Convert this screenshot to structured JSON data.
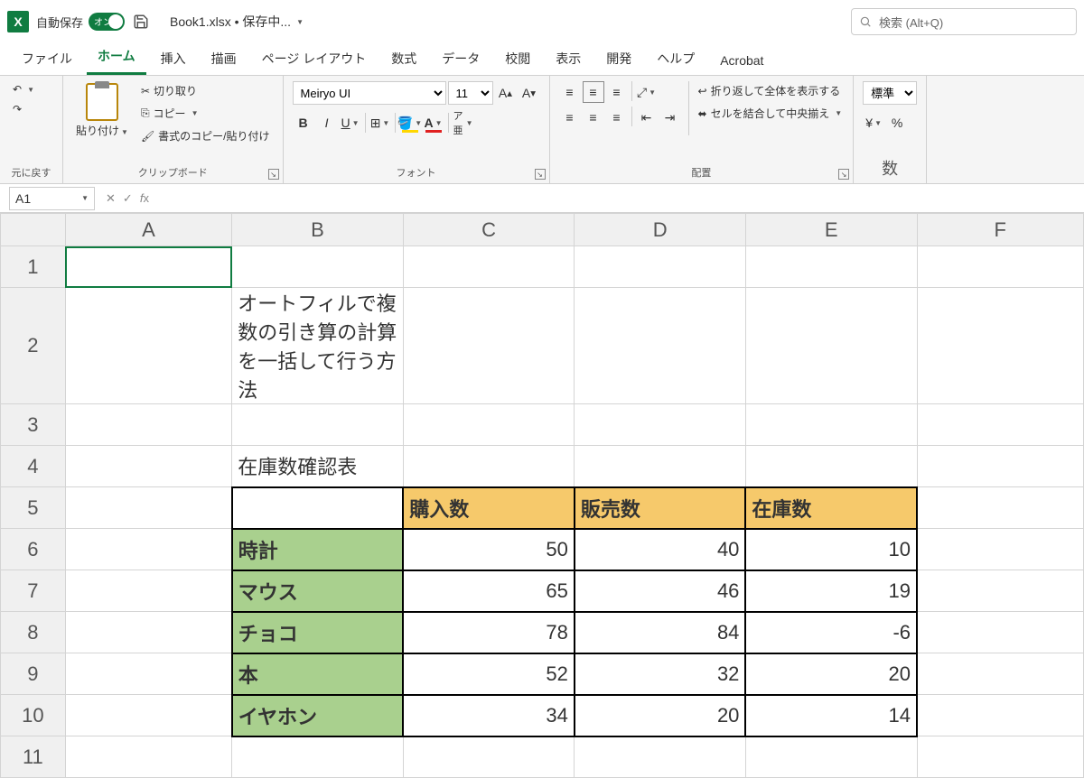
{
  "titlebar": {
    "autosave_label": "自動保存",
    "autosave_state": "オン",
    "filename": "Book1.xlsx • 保存中...",
    "search_placeholder": "検索 (Alt+Q)"
  },
  "tabs": [
    "ファイル",
    "ホーム",
    "挿入",
    "描画",
    "ページ レイアウト",
    "数式",
    "データ",
    "校閲",
    "表示",
    "開発",
    "ヘルプ",
    "Acrobat"
  ],
  "active_tab": "ホーム",
  "ribbon": {
    "undo_group": "元に戻す",
    "clipboard": {
      "paste": "貼り付け",
      "cut": "切り取り",
      "copy": "コピー",
      "format_painter": "書式のコピー/貼り付け",
      "label": "クリップボード"
    },
    "font": {
      "name": "Meiryo UI",
      "size": "11",
      "label": "フォント"
    },
    "alignment": {
      "wrap": "折り返して全体を表示する",
      "merge": "セルを結合して中央揃え",
      "label": "配置"
    },
    "number": {
      "style": "標準"
    }
  },
  "namebox": "A1",
  "formula": "",
  "columns": [
    "A",
    "B",
    "C",
    "D",
    "E",
    "F"
  ],
  "rows": [
    "1",
    "2",
    "3",
    "4",
    "5",
    "6",
    "7",
    "8",
    "9",
    "10",
    "11"
  ],
  "cells": {
    "B2": "オートフィルで複数の引き算の計算を一括して行う方法",
    "B4": "在庫数確認表",
    "C5": "購入数",
    "D5": "販売数",
    "E5": "在庫数",
    "B6": "時計",
    "C6": "50",
    "D6": "40",
    "E6": "10",
    "B7": "マウス",
    "C7": "65",
    "D7": "46",
    "E7": "19",
    "B8": "チョコ",
    "C8": "78",
    "D8": "84",
    "E8": "-6",
    "B9": "本",
    "C9": "52",
    "D9": "32",
    "E9": "20",
    "B10": "イヤホン",
    "C10": "34",
    "D10": "20",
    "E10": "14"
  }
}
